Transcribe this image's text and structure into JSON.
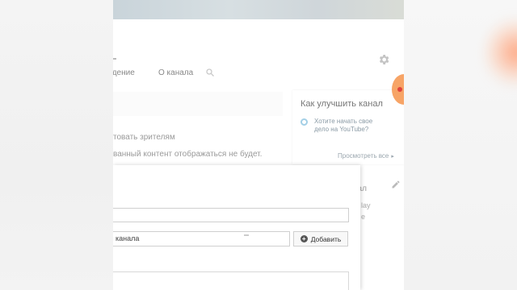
{
  "tabs": [
    {
      "label": "ждение"
    },
    {
      "label": "О канала"
    }
  ],
  "info": {
    "line1": "товать зрителям",
    "line2": "ванный контент отображаться не будет."
  },
  "sidebar_card": {
    "title": "Как улучшить канал",
    "item": "Хотите начать свое дело на YouTube?",
    "more": "Просмотреть все"
  },
  "sidebar_card2": {
    "title": "нал",
    "sub1": "lay",
    "sub2": "е"
  },
  "dialog": {
    "channel_value": "канала",
    "add_label": "Добавить"
  },
  "colors": {
    "fab": "#f7a466",
    "fab_dot": "#e0443c"
  }
}
